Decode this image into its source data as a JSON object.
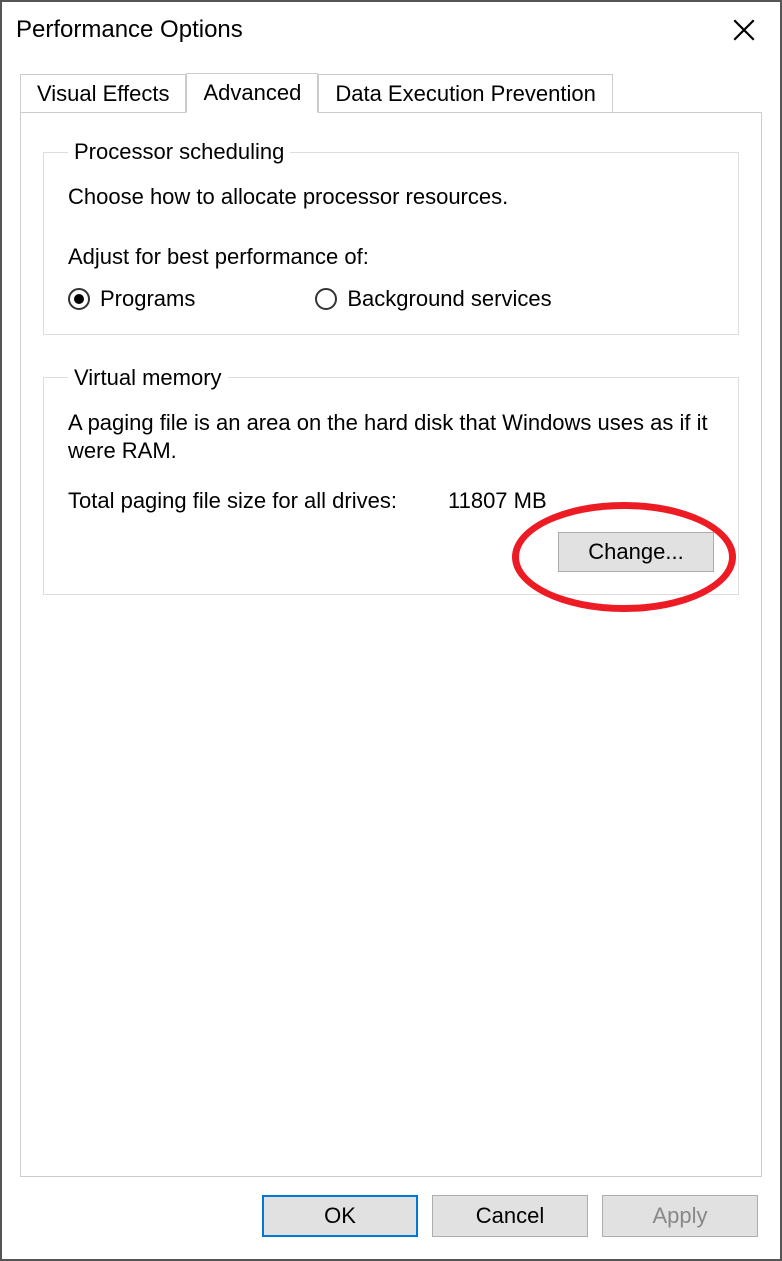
{
  "window": {
    "title": "Performance Options"
  },
  "tabs": {
    "visual_effects": "Visual Effects",
    "advanced": "Advanced",
    "dep": "Data Execution Prevention"
  },
  "processor_scheduling": {
    "legend": "Processor scheduling",
    "desc": "Choose how to allocate processor resources.",
    "sub": "Adjust for best performance of:",
    "opt_programs": "Programs",
    "opt_background": "Background services",
    "selected": "programs"
  },
  "virtual_memory": {
    "legend": "Virtual memory",
    "desc": "A paging file is an area on the hard disk that Windows uses as if it were RAM.",
    "total_label": "Total paging file size for all drives:",
    "total_value": "11807 MB",
    "change_label": "Change..."
  },
  "footer": {
    "ok": "OK",
    "cancel": "Cancel",
    "apply": "Apply"
  }
}
